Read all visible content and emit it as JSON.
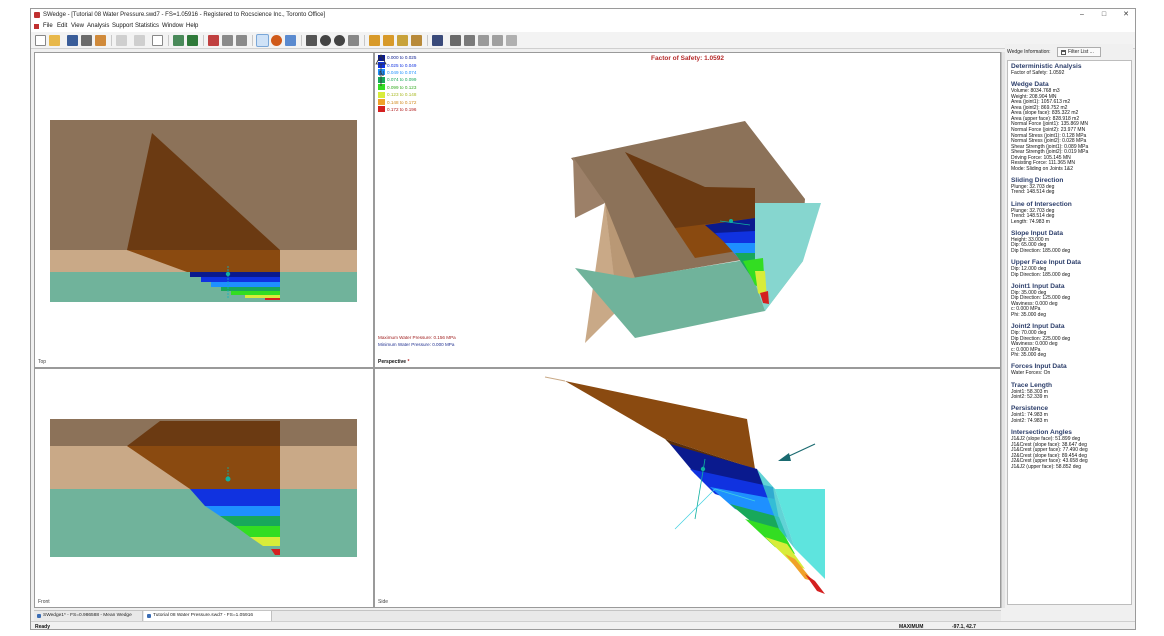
{
  "window": {
    "title": "SWedge - [Tutorial 08 Water Pressure.swd7 - FS=1.05916 - Registered to Rocscience Inc., Toronto Office]",
    "controls": [
      "–",
      "□",
      "✕"
    ]
  },
  "menu": [
    "File",
    "Edit",
    "View",
    "Analysis",
    "Support",
    "Statistics",
    "Window",
    "Help"
  ],
  "colors": {
    "accent_red": "#b52a2a",
    "section_heading": "#2d3f6b",
    "rock_upper": "#8c7259",
    "rock_band": "#c9a987",
    "water": "#70b39b",
    "wedge": "#8a4a10"
  },
  "views": {
    "top_label": "Top",
    "perspective_label": "Perspective",
    "perspective_marker": "*",
    "front_label": "Front",
    "side_label": "Side",
    "factor_of_safety": "Factor of Safety: 1.0592",
    "north_label": "N",
    "max_water_pressure": "Maximum Water Pressure: 0.156 MPa",
    "min_water_pressure": "Minimum Water Pressure: 0.000 MPa"
  },
  "legend": [
    {
      "label": "0.000 to 0.025",
      "color": "#0a1a8e"
    },
    {
      "label": "0.025 to 0.049",
      "color": "#1032e0"
    },
    {
      "label": "0.049 to 0.074",
      "color": "#1e90ff"
    },
    {
      "label": "0.074 to 0.099",
      "color": "#18a85a"
    },
    {
      "label": "0.099 to 0.123",
      "color": "#33dd22"
    },
    {
      "label": "0.123 to 0.148",
      "color": "#d8ec3a"
    },
    {
      "label": "0.148 to 0.172",
      "color": "#f0a12a"
    },
    {
      "label": "0.172 to 0.196",
      "color": "#d42020"
    }
  ],
  "info_panel": {
    "header": "Wedge Information:",
    "filter_button": "Filter List ...",
    "sections": [
      {
        "title": "Deterministic Analysis",
        "rows": [
          "Factor of Safety: 1.0592"
        ]
      },
      {
        "title": "Wedge Data",
        "rows": [
          "Volume: 8034.768 m3",
          "Weight: 208.904 MN",
          "Area (joint1): 1057.613 m2",
          "Area (joint2): 869.752 m2",
          "Area (slope face): 835.322 m2",
          "Area (upper face): 828.918 m2",
          "Normal Force (joint1): 135.869 MN",
          "Normal Force (joint2): 23.977 MN",
          "Normal Stress (joint1): 0.128 MPa",
          "Normal Stress (joint2): 0.028 MPa",
          "Shear Strength (joint1): 0.089 MPa",
          "Shear Strength (joint2): 0.019 MPa",
          "Driving Force: 105.145 MN",
          "Resisting Force: 111.365 MN",
          "Mode: Sliding on Joints 1&2"
        ]
      },
      {
        "title": "Sliding Direction",
        "rows": [
          "Plunge: 32.703 deg",
          "Trend: 148.514 deg"
        ]
      },
      {
        "title": "Line of Intersection",
        "rows": [
          "Plunge: 32.703 deg",
          "Trend: 148.514 deg",
          "Length: 74.983 m"
        ]
      },
      {
        "title": "Slope Input Data",
        "rows": [
          "Height: 33.000 m",
          "Dip: 65.000 deg",
          "Dip Direction: 185.000 deg"
        ]
      },
      {
        "title": "Upper Face Input Data",
        "rows": [
          "Dip: 12.000 deg",
          "Dip Direction: 185.000 deg"
        ]
      },
      {
        "title": "Joint1 Input Data",
        "rows": [
          "Dip: 35.000 deg",
          "Dip Direction: 125.000 deg",
          "Waviness: 0.000 deg",
          "c: 0.000 MPa",
          "Phi: 35.000 deg"
        ]
      },
      {
        "title": "Joint2 Input Data",
        "rows": [
          "Dip: 70.000 deg",
          "Dip Direction: 225.000 deg",
          "Waviness: 0.000 deg",
          "c: 0.000 MPa",
          "Phi: 35.000 deg"
        ]
      },
      {
        "title": "Forces Input Data",
        "rows": [
          "Water Forces: On"
        ]
      },
      {
        "title": "Trace Length",
        "rows": [
          "Joint1: 58.303 m",
          "Joint2: 52.339 m"
        ]
      },
      {
        "title": "Persistence",
        "rows": [
          "Joint1: 74.983 m",
          "Joint2: 74.983 m"
        ]
      },
      {
        "title": "Intersection Angles",
        "rows": [
          "J1&J2 (slope face): 51.899 deg",
          "J1&Crest (slope face): 38.647 deg",
          "J1&Crest (upper face): 77.490 deg",
          "J2&Crest (slope face): 89.454 deg",
          "J2&Crest (upper face): 43.658 deg",
          "J1&J2 (upper face): 58.852 deg"
        ]
      }
    ]
  },
  "tabs": [
    {
      "label": "SWedge1* - FS=0.986588 - Mean Wedge"
    },
    {
      "label": "Tutorial 08 Water Pressure.swd7 - FS=1.05916"
    }
  ],
  "status": {
    "left": "Ready",
    "mode": "MAXIMUM",
    "coords": "-97.1, 42.7"
  }
}
